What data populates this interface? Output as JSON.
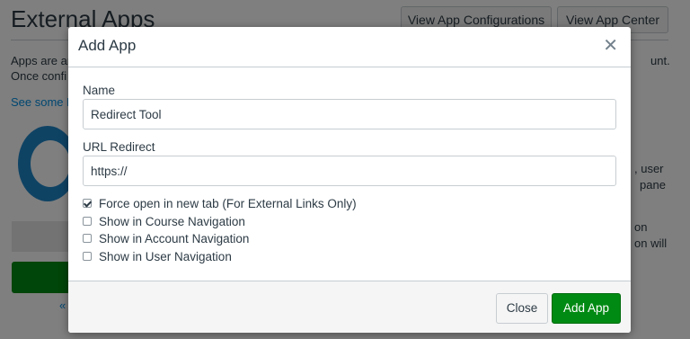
{
  "background": {
    "title": "External Apps",
    "buttons": {
      "configurations": "View App Configurations",
      "center": "View App Center"
    },
    "text_line1": "Apps are ar",
    "text_line2": "Once confi",
    "text_right1": "unt.",
    "link": "See some L",
    "right_frag1": ", user",
    "right_frag2": "pane",
    "right_frag3": "on",
    "right_frag4": "on will",
    "pager": "«"
  },
  "modal": {
    "title": "Add App",
    "close_glyph": "✕",
    "name_label": "Name",
    "name_value": "Redirect Tool",
    "url_label": "URL Redirect",
    "url_value": "https://",
    "checkboxes": [
      {
        "label": "Force open in new tab (For External Links Only)",
        "checked": true
      },
      {
        "label": "Show in Course Navigation",
        "checked": false
      },
      {
        "label": "Show in Account Navigation",
        "checked": false
      },
      {
        "label": "Show in User Navigation",
        "checked": false
      }
    ],
    "close_button": "Close",
    "add_button": "Add App"
  },
  "colors": {
    "primary_button": "#008a13",
    "link": "#008ee2",
    "text": "#2d3b45"
  },
  "icons": {
    "close": "close-icon",
    "checkbox": "checkbox-icon"
  }
}
